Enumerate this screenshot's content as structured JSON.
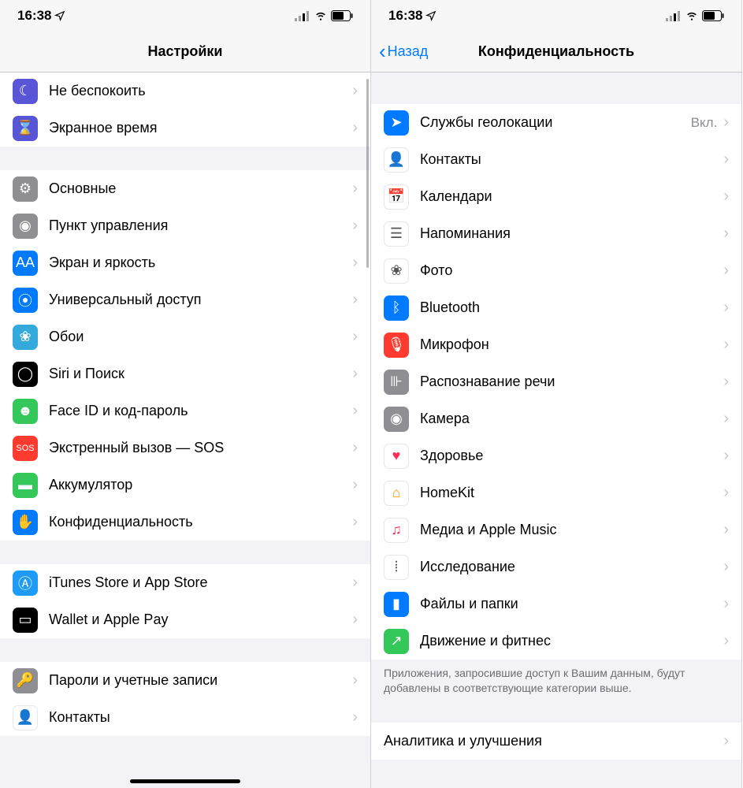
{
  "status": {
    "time": "16:38",
    "location_arrow": "➤"
  },
  "left": {
    "title": "Настройки",
    "groups": [
      {
        "items": [
          {
            "key": "dnd",
            "label": "Не беспокоить",
            "icon_bg": "#5856d6",
            "glyph": "☾"
          },
          {
            "key": "screentime",
            "label": "Экранное время",
            "icon_bg": "#5856d6",
            "glyph": "⌛"
          }
        ]
      },
      {
        "items": [
          {
            "key": "general",
            "label": "Основные",
            "icon_bg": "#8e8e93",
            "glyph": "⚙"
          },
          {
            "key": "controlcenter",
            "label": "Пункт управления",
            "icon_bg": "#8e8e93",
            "glyph": "◉"
          },
          {
            "key": "display",
            "label": "Экран и яркость",
            "icon_bg": "#007aff",
            "glyph": "AA"
          },
          {
            "key": "accessibility",
            "label": "Универсальный доступ",
            "icon_bg": "#007aff",
            "glyph": "⦿"
          },
          {
            "key": "wallpaper",
            "label": "Обои",
            "icon_bg": "#34aadc",
            "glyph": "❀"
          },
          {
            "key": "siri",
            "label": "Siri и Поиск",
            "icon_bg": "#000000",
            "glyph": "◯"
          },
          {
            "key": "faceid",
            "label": "Face ID и код-пароль",
            "icon_bg": "#34c759",
            "glyph": "☻"
          },
          {
            "key": "sos",
            "label": "Экстренный вызов — SOS",
            "icon_bg": "#ff3b30",
            "glyph": "SOS"
          },
          {
            "key": "battery",
            "label": "Аккумулятор",
            "icon_bg": "#34c759",
            "glyph": "▬"
          },
          {
            "key": "privacy",
            "label": "Конфиденциальность",
            "icon_bg": "#007aff",
            "glyph": "✋"
          }
        ]
      },
      {
        "items": [
          {
            "key": "itunes",
            "label": "iTunes Store и App Store",
            "icon_bg": "#1d9bf6",
            "glyph": "Ⓐ"
          },
          {
            "key": "wallet",
            "label": "Wallet и Apple Pay",
            "icon_bg": "#000000",
            "glyph": "▭"
          }
        ]
      },
      {
        "items": [
          {
            "key": "passwords",
            "label": "Пароли и учетные записи",
            "icon_bg": "#8e8e93",
            "glyph": "🔑"
          },
          {
            "key": "contacts",
            "label": "Контакты",
            "icon_bg": "#ffffff",
            "glyph": "👤",
            "white": true
          }
        ]
      }
    ]
  },
  "right": {
    "back": "Назад",
    "title": "Конфиденциальность",
    "groups": [
      {
        "items": [
          {
            "key": "location",
            "label": "Службы геолокации",
            "value": "Вкл.",
            "icon_bg": "#007aff",
            "glyph": "➤"
          },
          {
            "key": "contacts",
            "label": "Контакты",
            "icon_bg": "#ffffff",
            "glyph": "👤",
            "white": true
          },
          {
            "key": "calendars",
            "label": "Календари",
            "icon_bg": "#ffffff",
            "glyph": "📅",
            "white": true
          },
          {
            "key": "reminders",
            "label": "Напоминания",
            "icon_bg": "#ffffff",
            "glyph": "☰",
            "white": true
          },
          {
            "key": "photos",
            "label": "Фото",
            "icon_bg": "#ffffff",
            "glyph": "❀",
            "white": true
          },
          {
            "key": "bluetooth",
            "label": "Bluetooth",
            "icon_bg": "#007aff",
            "glyph": "ᛒ"
          },
          {
            "key": "microphone",
            "label": "Микрофон",
            "icon_bg": "#ff3b30",
            "glyph": "🎙"
          },
          {
            "key": "speech",
            "label": "Распознавание речи",
            "icon_bg": "#8e8e93",
            "glyph": "⊪"
          },
          {
            "key": "camera",
            "label": "Камера",
            "icon_bg": "#8e8e93",
            "glyph": "◉"
          },
          {
            "key": "health",
            "label": "Здоровье",
            "icon_bg": "#ffffff",
            "glyph": "♥",
            "white": true,
            "glyph_color": "#ff2d55"
          },
          {
            "key": "homekit",
            "label": "HomeKit",
            "icon_bg": "#ffffff",
            "glyph": "⌂",
            "white": true,
            "glyph_color": "#ff9500"
          },
          {
            "key": "media",
            "label": "Медиа и Apple Music",
            "icon_bg": "#ffffff",
            "glyph": "♫",
            "white": true,
            "glyph_color": "#ff2d55"
          },
          {
            "key": "research",
            "label": "Исследование",
            "icon_bg": "#ffffff",
            "glyph": "⦙",
            "white": true
          },
          {
            "key": "files",
            "label": "Файлы и папки",
            "icon_bg": "#007aff",
            "glyph": "▮"
          },
          {
            "key": "motion",
            "label": "Движение и фитнес",
            "icon_bg": "#34c759",
            "glyph": "↗"
          }
        ],
        "footer": "Приложения, запросившие доступ к Вашим данным, будут добавлены в соответствующие категории выше."
      },
      {
        "items": [
          {
            "key": "analytics",
            "label": "Аналитика и улучшения",
            "icon_bg": "",
            "glyph": "",
            "no_icon": true
          }
        ]
      }
    ]
  }
}
